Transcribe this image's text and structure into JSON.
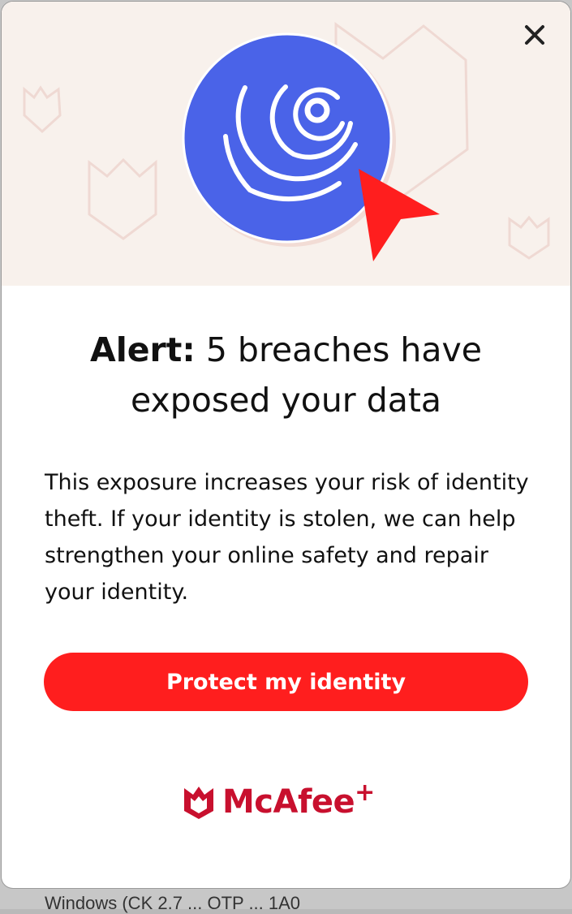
{
  "background": {
    "partial_text": "Windows (CK 2.7 ... OTP ... 1A0"
  },
  "popup": {
    "close_icon": "close-icon",
    "hero_icon": "radar-scan-icon",
    "cursor_icon": "pointer-arrow-icon",
    "headline_strong": "Alert:",
    "headline_rest": " 5 breaches have exposed your data",
    "body": "This exposure increases your risk of identity theft. If your identity is stolen, we can help strengthen your online safety and repair your identity.",
    "cta_label": "Protect my identity",
    "brand_name": "McAfee",
    "brand_plus": "+",
    "brand_icon": "mcafee-shield-icon"
  },
  "colors": {
    "hero_background": "#f8f1ec",
    "hero_circle": "#4a63e8",
    "accent_red": "#ff1e1e",
    "brand_red": "#c8102e"
  }
}
